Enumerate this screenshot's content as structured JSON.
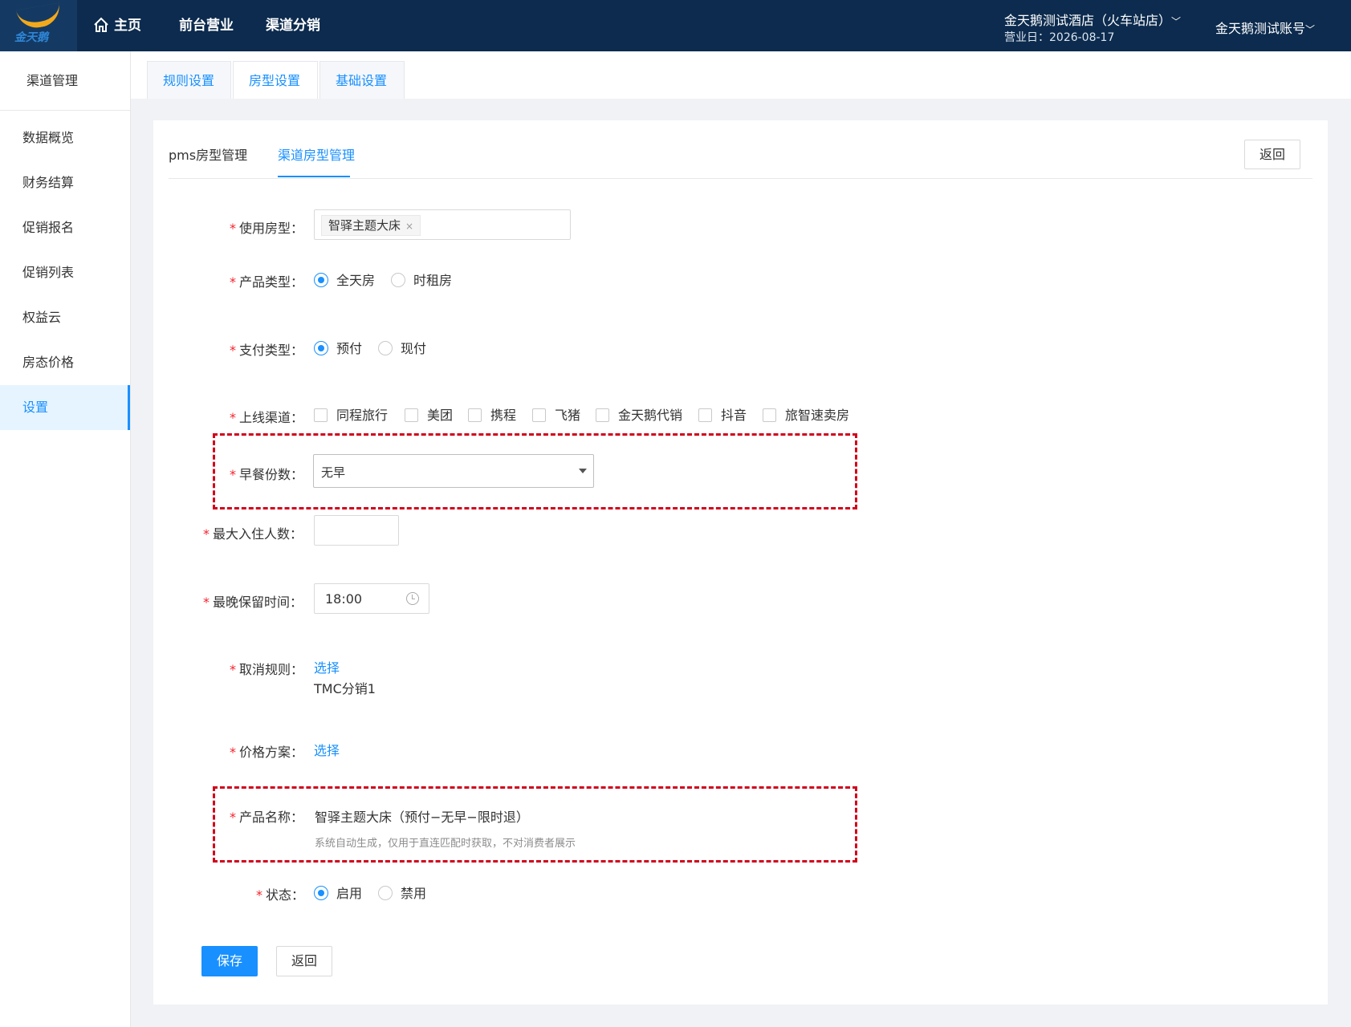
{
  "brand": {
    "logo_text": "金天鹅"
  },
  "topnav": {
    "home": "主页",
    "front_desk": "前台营业",
    "channel_distribution": "渠道分销",
    "hotel_name": "金天鹅测试酒店（火车站店）",
    "business_date": "营业日：2026-08-17",
    "account": "金天鹅测试账号"
  },
  "sidebar": {
    "title": "渠道管理",
    "items": [
      {
        "label": "数据概览"
      },
      {
        "label": "财务结算"
      },
      {
        "label": "促销报名"
      },
      {
        "label": "促销列表"
      },
      {
        "label": "权益云"
      },
      {
        "label": "房态价格"
      },
      {
        "label": "设置",
        "active": true
      }
    ]
  },
  "tabs": [
    {
      "label": "规则设置"
    },
    {
      "label": "房型设置",
      "active": true
    },
    {
      "label": "基础设置"
    }
  ],
  "subtabs": [
    {
      "label": "pms房型管理"
    },
    {
      "label": "渠道房型管理",
      "active": true
    }
  ],
  "back_button": "返回",
  "form": {
    "room_type": {
      "label": "使用房型：",
      "tag": "智驿主题大床"
    },
    "product_type": {
      "label": "产品类型：",
      "options": [
        "全天房",
        "时租房"
      ],
      "selected": "全天房"
    },
    "payment_type": {
      "label": "支付类型：",
      "options": [
        "预付",
        "现付"
      ],
      "selected": "预付"
    },
    "channels": {
      "label": "上线渠道：",
      "options": [
        "同程旅行",
        "美团",
        "携程",
        "飞猪",
        "金天鹅代销",
        "抖音",
        "旅智速卖房"
      ]
    },
    "breakfast": {
      "label": "早餐份数：",
      "value": "无早"
    },
    "max_guests": {
      "label": "最大入住人数：",
      "value": ""
    },
    "latest_hold": {
      "label": "最晚保留时间：",
      "value": "18:00"
    },
    "cancel_rule": {
      "label": "取消规则：",
      "link": "选择",
      "value": "TMC分销1"
    },
    "price_plan": {
      "label": "价格方案：",
      "link": "选择"
    },
    "product_name": {
      "label": "产品名称：",
      "value": "智驿主题大床（预付−无早−限时退）",
      "hint": "系统自动生成，仅用于直连匹配时获取，不对消费者展示"
    },
    "status": {
      "label": "状态：",
      "options": [
        "启用",
        "禁用"
      ],
      "selected": "启用"
    }
  },
  "actions": {
    "save": "保存",
    "back": "返回"
  },
  "colors": {
    "topbar": "#0c2b4e",
    "accent": "#1890ff",
    "required": "#f5222d",
    "highlight": "#d0021b"
  }
}
